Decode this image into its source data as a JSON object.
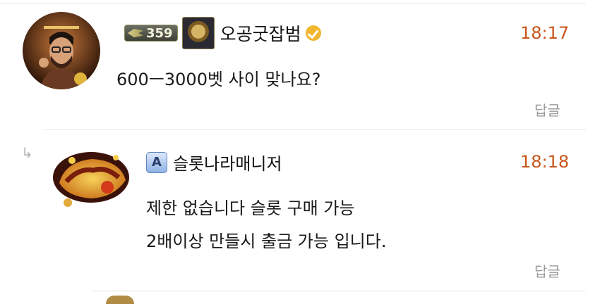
{
  "comments": [
    {
      "level": "359",
      "username": "오공굿잡범",
      "time": "18:17",
      "text": "600ㅡ3000벳 사이 맞나요?",
      "reply_label": "답글"
    },
    {
      "username": "슬롯나라매니저",
      "manager_icon_letter": "A",
      "time": "18:18",
      "lines": [
        "제한 없습니다 슬롯 구매 가능",
        "2배이상 만들시 출금 가능 입니다."
      ],
      "reply_label": "답글"
    }
  ],
  "colors": {
    "time": "#c8551a",
    "reply": "#9a9a9a",
    "verified": "#f0b72f"
  }
}
